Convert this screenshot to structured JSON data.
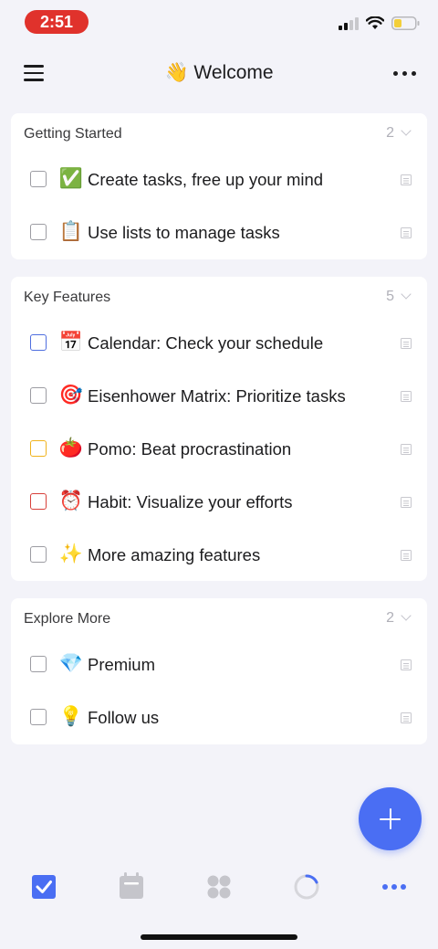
{
  "status_bar": {
    "time": "2:51"
  },
  "nav": {
    "title": "👋 Welcome"
  },
  "sections": [
    {
      "title": "Getting Started",
      "count": "2",
      "tasks": [
        {
          "emoji": "✅",
          "text": "Create tasks, free up your mind",
          "priority": "none"
        },
        {
          "emoji": "📋",
          "text": "Use lists to manage tasks",
          "priority": "none"
        }
      ]
    },
    {
      "title": "Key Features",
      "count": "5",
      "tasks": [
        {
          "emoji": "📅",
          "text": "Calendar: Check your schedule",
          "priority": "low"
        },
        {
          "emoji": "🎯",
          "text": "Eisenhower Matrix: Prioritize tasks",
          "priority": "none"
        },
        {
          "emoji": "🍅",
          "text": "Pomo: Beat procrastination",
          "priority": "medium"
        },
        {
          "emoji": "⏰",
          "text": "Habit: Visualize your efforts",
          "priority": "high"
        },
        {
          "emoji": "✨",
          "text": "More amazing features",
          "priority": "none"
        }
      ]
    },
    {
      "title": "Explore More",
      "count": "2",
      "tasks": [
        {
          "emoji": "💎",
          "text": "Premium",
          "priority": "none"
        },
        {
          "emoji": "💡",
          "text": "Follow us",
          "priority": "none"
        }
      ]
    }
  ],
  "tabbar": {
    "tabs": [
      {
        "name": "tasks",
        "icon": "checkbox-icon",
        "active": true
      },
      {
        "name": "calendar",
        "icon": "calendar-icon",
        "active": false
      },
      {
        "name": "matrix",
        "icon": "four-squares-icon",
        "active": false
      },
      {
        "name": "pomo",
        "icon": "timer-ring-icon",
        "active": false
      },
      {
        "name": "more",
        "icon": "more-dots-icon",
        "active": false
      }
    ]
  },
  "colors": {
    "accent": "#4a6ef3",
    "priority_low": "#4f6edf",
    "priority_medium": "#f0b31d",
    "priority_high": "#d7403a",
    "status_recording": "#e0322c"
  }
}
